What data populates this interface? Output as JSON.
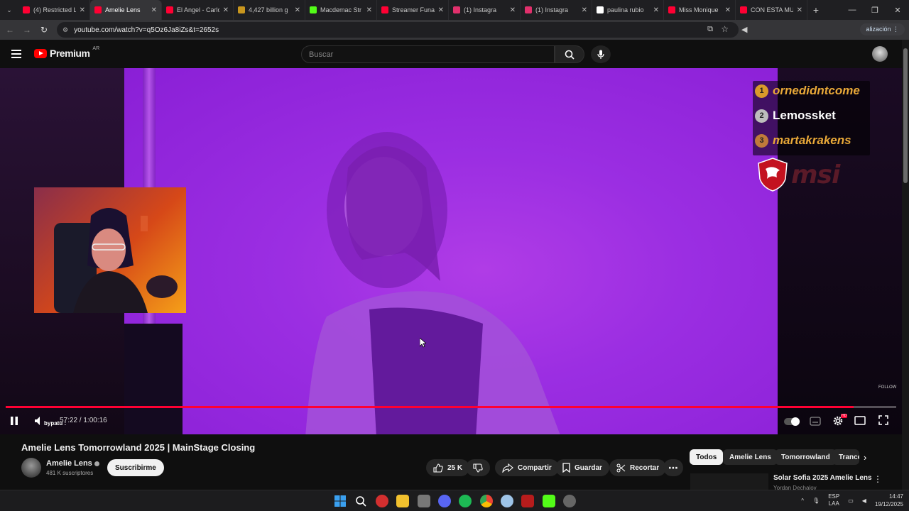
{
  "browser": {
    "tabs": [
      {
        "title": "(4) Restricted L",
        "color": "#ff0033"
      },
      {
        "title": "Amelie Lens",
        "color": "#ff0033",
        "active": true
      },
      {
        "title": "El Angel - Carlo",
        "color": "#ff0033"
      },
      {
        "title": "4,427 billion g",
        "color": "#c8961e"
      },
      {
        "title": "Macdemac Str",
        "color": "#53fc18"
      },
      {
        "title": "Streamer Funa",
        "color": "#ff0033"
      },
      {
        "title": "(1) Instagra",
        "color": "#e1306c"
      },
      {
        "title": "(1) Instagra",
        "color": "#e1306c"
      },
      {
        "title": "paulina rubio",
        "color": "#ffffff"
      },
      {
        "title": "Miss Monique",
        "color": "#ff0033"
      },
      {
        "title": "CON ESTA MU",
        "color": "#ff0033"
      }
    ],
    "tab_close": "✕",
    "new_tab": "+",
    "url": "youtube.com/watch?v=q5Oz6Ja8iZs&t=2652s",
    "update_label": "alización"
  },
  "youtube": {
    "logo_word": "Premium",
    "country": "AR",
    "search_placeholder": "Buscar"
  },
  "overlay": {
    "leaderboard": [
      {
        "rank": "1",
        "name": "ornedidntcome",
        "color": "#e8a838",
        "rank_bg": "#d99a2a"
      },
      {
        "rank": "2",
        "name": "Lemossket",
        "color": "#ffffff",
        "rank_bg": "#bdbdbd"
      },
      {
        "rank": "3",
        "name": "martakrakens",
        "color": "#e8a838",
        "rank_bg": "#c07a3a"
      }
    ],
    "sponsor": "msi",
    "follow_text": "FOLLOW",
    "chat_user": "bypatu :"
  },
  "player": {
    "time_current": "57:22",
    "time_total": "1:00:16",
    "progress_fraction": 0.952
  },
  "video": {
    "title": "Amelie Lens Tomorrowland 2025 | MainStage Closing",
    "channel": "Amelie Lens",
    "subscribers": "481 K suscriptores",
    "subscribe_label": "Suscribirme",
    "likes": "25 K",
    "share_label": "Compartir",
    "save_label": "Guardar",
    "clip_label": "Recortar"
  },
  "sidebar": {
    "chips": [
      "Todos",
      "Amelie Lens",
      "Tomorrowland",
      "Trance"
    ],
    "rec_title": "Solar Sofia 2025 Amelie Lens",
    "rec_sub": "Yordan Dechalov"
  },
  "taskbar": {
    "lang_top": "ESP",
    "lang_bottom": "LAA",
    "time": "14:47",
    "date": "19/12/2025"
  }
}
